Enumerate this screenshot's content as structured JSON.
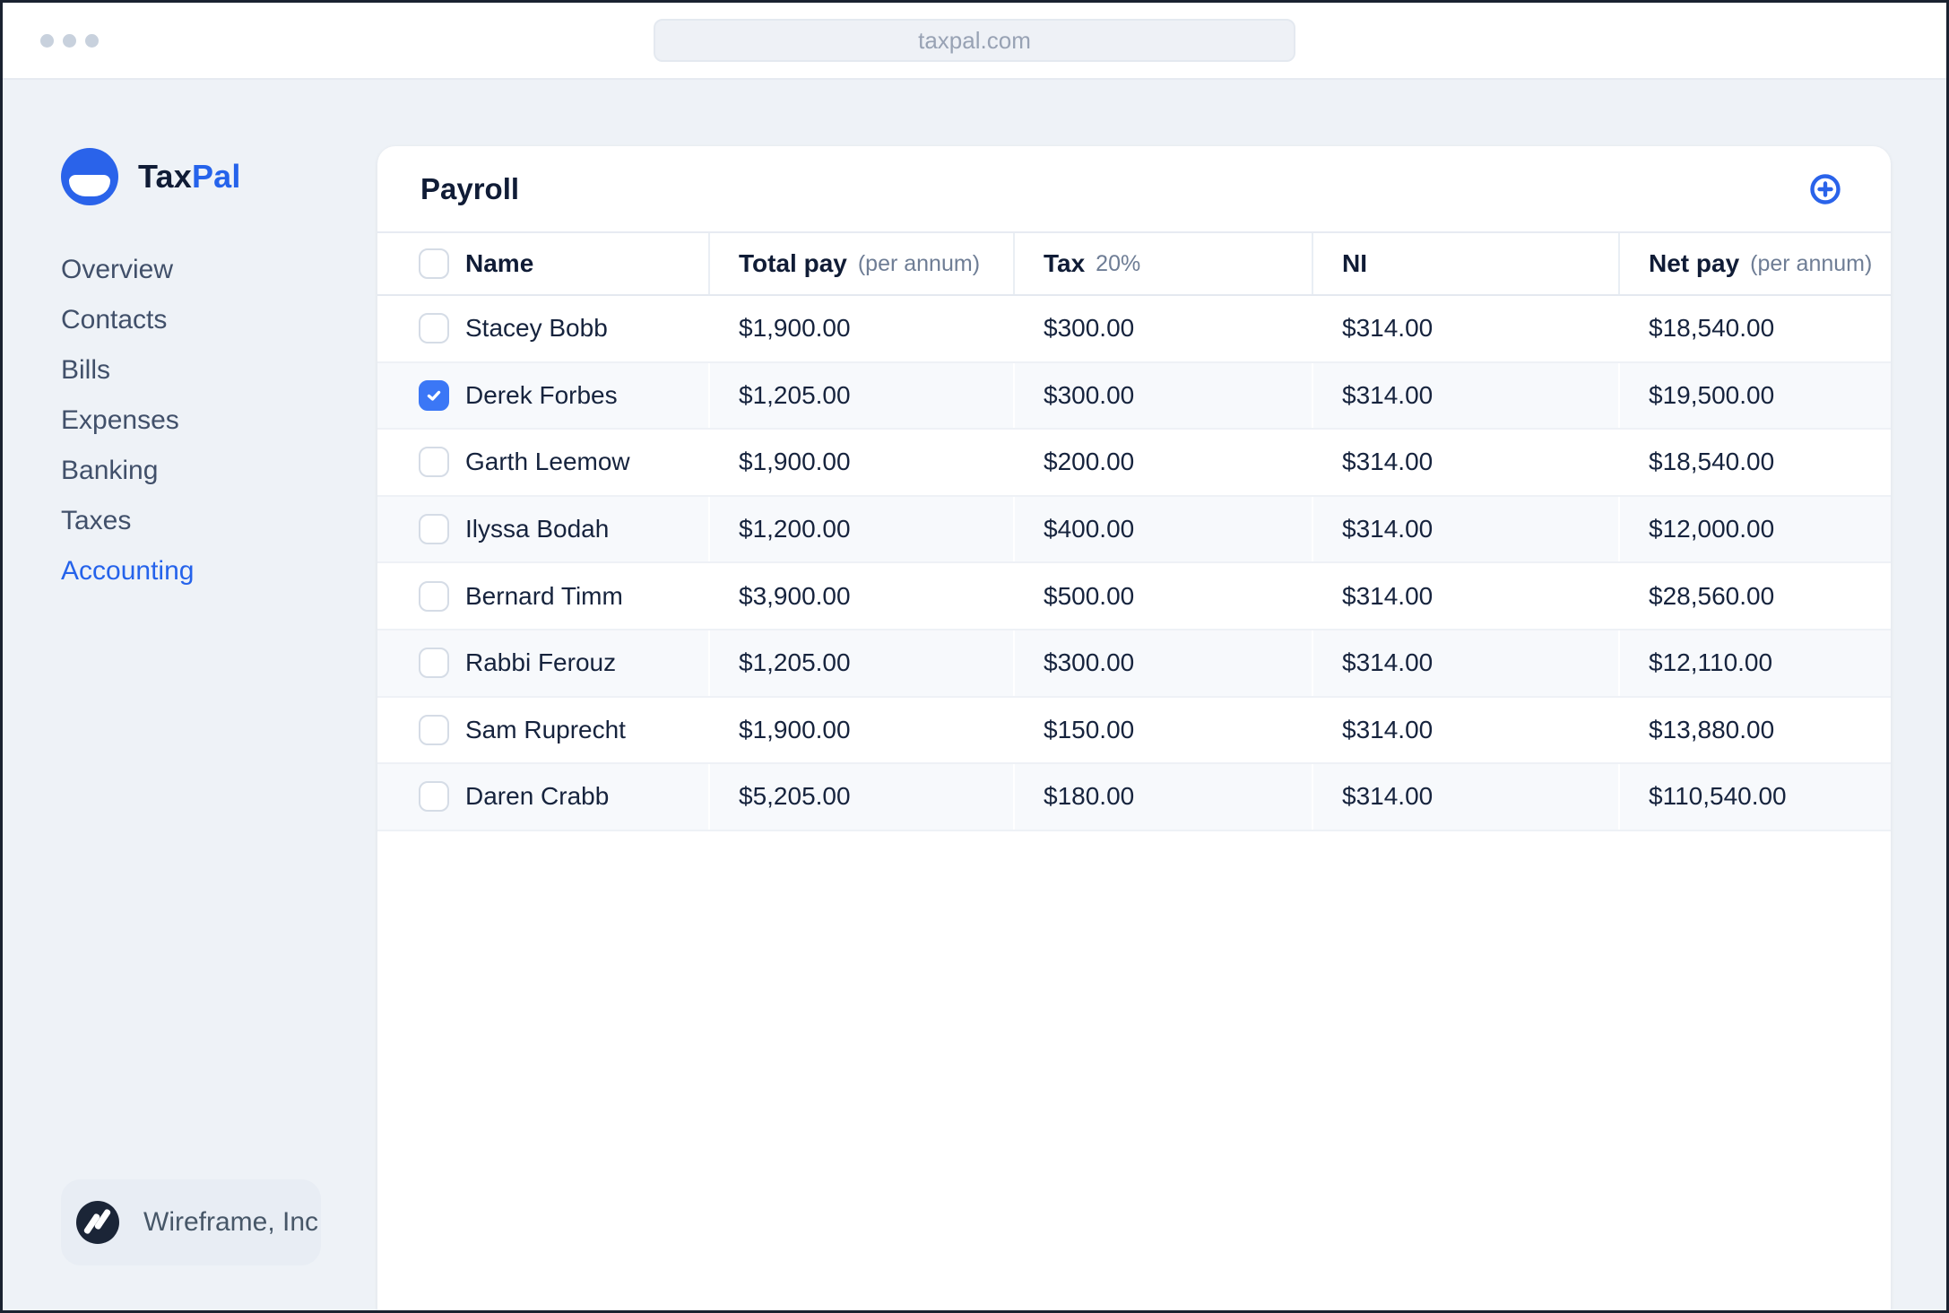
{
  "browser": {
    "url": "taxpal.com"
  },
  "colors": {
    "accent_blue": "#2563eb",
    "checkbox_checked": "#3b77f6",
    "page_background": "#eef2f7",
    "card_background": "#ffffff",
    "row_stripe": "#f7f9fc",
    "dark_text": "#101c36",
    "muted_text": "#6e7d95"
  },
  "sidebar": {
    "brand": {
      "name_primary": "Tax",
      "name_accent": "Pal"
    },
    "items": [
      {
        "label": "Overview",
        "active": false
      },
      {
        "label": "Contacts",
        "active": false
      },
      {
        "label": "Bills",
        "active": false
      },
      {
        "label": "Expenses",
        "active": false
      },
      {
        "label": "Banking",
        "active": false
      },
      {
        "label": "Taxes",
        "active": false
      },
      {
        "label": "Accounting",
        "active": true
      }
    ],
    "footer": {
      "company": "Wireframe, Inc"
    }
  },
  "main": {
    "title": "Payroll",
    "table": {
      "columns": [
        {
          "label": "Name",
          "sub": ""
        },
        {
          "label": "Total pay",
          "sub": "(per annum)"
        },
        {
          "label": "Tax",
          "sub": "20%"
        },
        {
          "label": "NI",
          "sub": ""
        },
        {
          "label": "Net pay",
          "sub": "(per annum)"
        }
      ],
      "rows": [
        {
          "checked": false,
          "name": "Stacey Bobb",
          "total_pay": "$1,900.00",
          "tax": "$300.00",
          "ni": "$314.00",
          "net_pay": "$18,540.00"
        },
        {
          "checked": true,
          "name": "Derek Forbes",
          "total_pay": "$1,205.00",
          "tax": "$300.00",
          "ni": "$314.00",
          "net_pay": "$19,500.00"
        },
        {
          "checked": false,
          "name": "Garth Leemow",
          "total_pay": "$1,900.00",
          "tax": "$200.00",
          "ni": "$314.00",
          "net_pay": "$18,540.00"
        },
        {
          "checked": false,
          "name": "Ilyssa Bodah",
          "total_pay": "$1,200.00",
          "tax": "$400.00",
          "ni": "$314.00",
          "net_pay": "$12,000.00"
        },
        {
          "checked": false,
          "name": "Bernard Timm",
          "total_pay": "$3,900.00",
          "tax": "$500.00",
          "ni": "$314.00",
          "net_pay": "$28,560.00"
        },
        {
          "checked": false,
          "name": "Rabbi Ferouz",
          "total_pay": "$1,205.00",
          "tax": "$300.00",
          "ni": "$314.00",
          "net_pay": "$12,110.00"
        },
        {
          "checked": false,
          "name": "Sam Ruprecht",
          "total_pay": "$1,900.00",
          "tax": "$150.00",
          "ni": "$314.00",
          "net_pay": "$13,880.00"
        },
        {
          "checked": false,
          "name": "Daren Crabb",
          "total_pay": "$5,205.00",
          "tax": "$180.00",
          "ni": "$314.00",
          "net_pay": "$110,540.00"
        }
      ]
    }
  }
}
